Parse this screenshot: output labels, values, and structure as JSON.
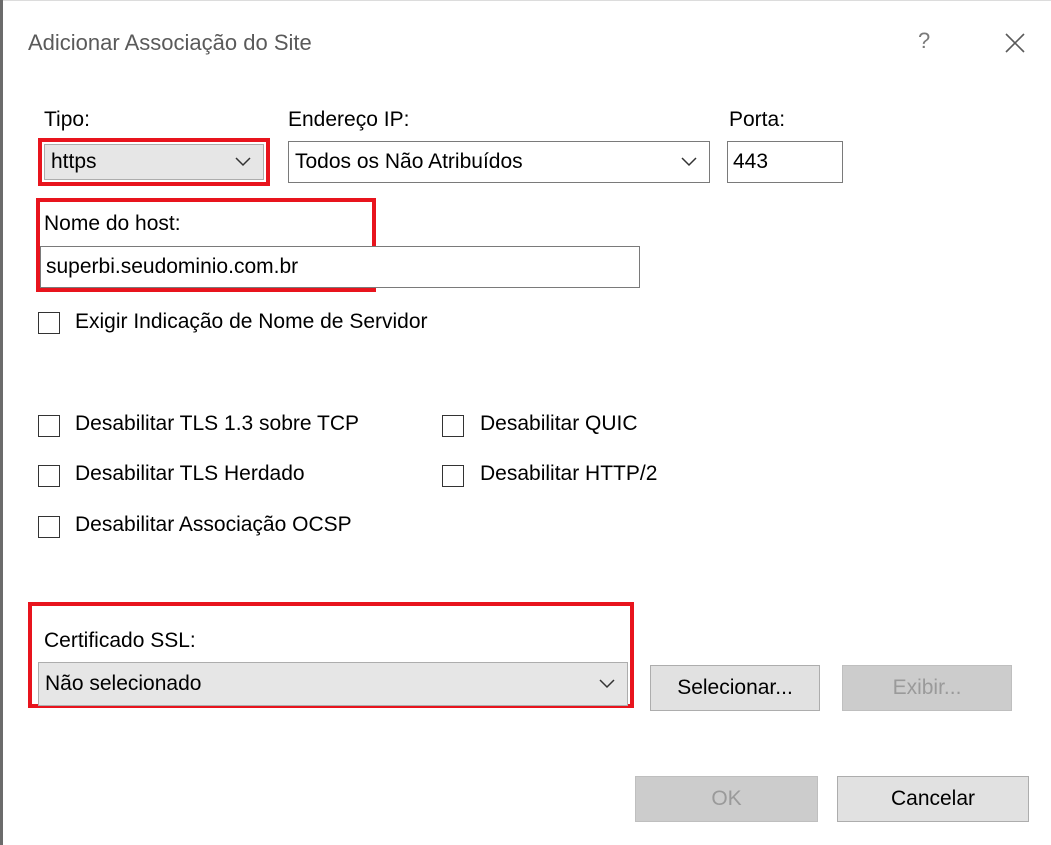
{
  "window": {
    "title": "Adicionar Associação do Site",
    "help_icon": "?",
    "close_icon": "close-x"
  },
  "tipo": {
    "label": "Tipo:",
    "value": "https"
  },
  "endereco_ip": {
    "label": "Endereço IP:",
    "value": "Todos os Não Atribuídos"
  },
  "porta": {
    "label": "Porta:",
    "value": "443"
  },
  "host": {
    "label": "Nome do host:",
    "value": "superbi.seudominio.com.br"
  },
  "checkboxes": {
    "exigir_sni": {
      "label": "Exigir Indicação de Nome de Servidor",
      "checked": false
    },
    "disable_tls13": {
      "label": "Desabilitar TLS 1.3 sobre TCP",
      "checked": false
    },
    "disable_quic": {
      "label": "Desabilitar QUIC",
      "checked": false
    },
    "disable_legacy_tls": {
      "label": "Desabilitar TLS Herdado",
      "checked": false
    },
    "disable_http2": {
      "label": "Desabilitar HTTP/2",
      "checked": false
    },
    "disable_ocsp": {
      "label": "Desabilitar Associação OCSP",
      "checked": false
    }
  },
  "ssl": {
    "label": "Certificado SSL:",
    "value": "Não selecionado",
    "select_button": "Selecionar...",
    "view_button": "Exibir..."
  },
  "footer": {
    "ok_label": "OK",
    "cancel_label": "Cancelar"
  },
  "colors": {
    "highlight": "#e8141d",
    "disabled_button": "#cccccc",
    "button": "#e1e1e1"
  }
}
